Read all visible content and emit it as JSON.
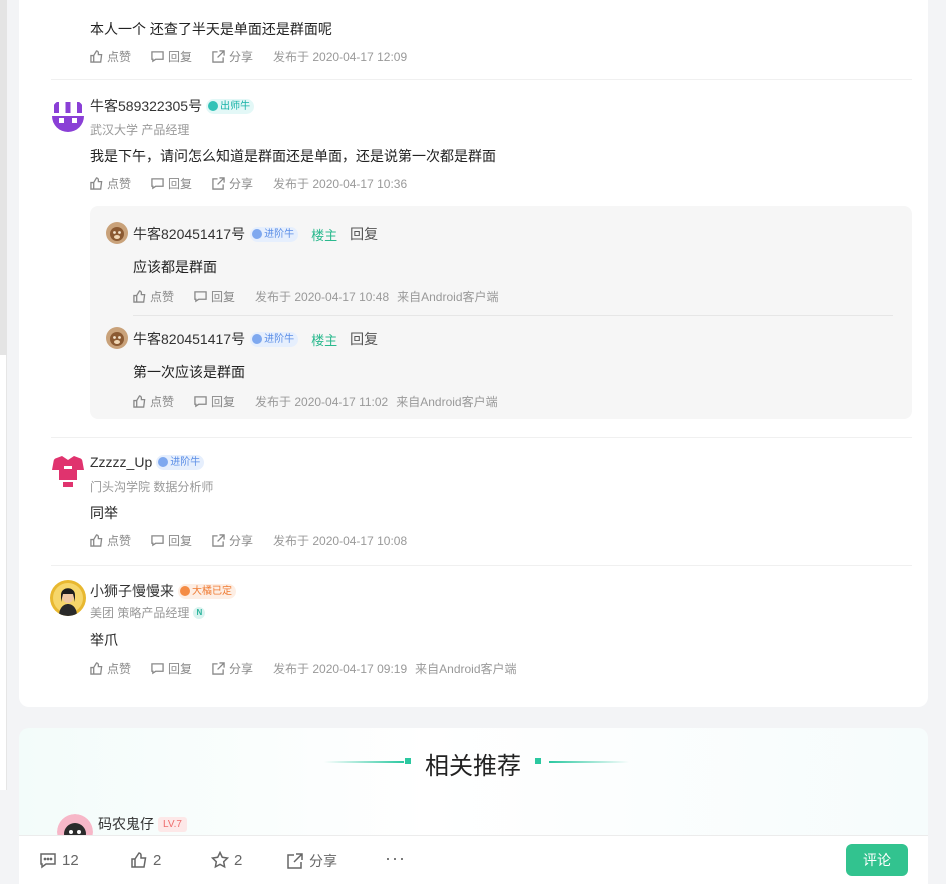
{
  "actions": {
    "like": "点赞",
    "reply": "回复",
    "share": "分享"
  },
  "comments": [
    {
      "text": "本人一个 还查了半天是单面还是群面呢",
      "meta": "发布于 2020-04-17 12:09"
    },
    {
      "name": "牛客589322305号",
      "badge": "出师牛",
      "sub": "武汉大学 产品经理",
      "text": "我是下午，请问怎么知道是群面还是单面，还是说第一次都是群面",
      "meta": "发布于 2020-04-17 10:36",
      "replies": [
        {
          "name": "牛客820451417号",
          "badge": "进阶牛",
          "tag": "楼主",
          "reply_label": "回复",
          "text": "应该都是群面",
          "meta": "发布于 2020-04-17 10:48",
          "client": "来自Android客户端"
        },
        {
          "name": "牛客820451417号",
          "badge": "进阶牛",
          "tag": "楼主",
          "reply_label": "回复",
          "text": "第一次应该是群面",
          "meta": "发布于 2020-04-17 11:02",
          "client": "来自Android客户端"
        }
      ]
    },
    {
      "name": "Zzzzz_Up",
      "badge": "进阶牛",
      "sub": "门头沟学院 数据分析师",
      "text": "同举",
      "meta": "发布于 2020-04-17 10:08"
    },
    {
      "name": "小狮子慢慢来",
      "badge": "大橘已定",
      "sub": "美团 策略产品经理",
      "sub_icon": "N",
      "text": "举爪",
      "meta": "发布于 2020-04-17 09:19",
      "client": "来自Android客户端"
    }
  ],
  "recommend": {
    "title": "相关推荐",
    "user": "码农鬼仔",
    "level": "LV.7"
  },
  "bottom_bar": {
    "comments": "12",
    "likes": "2",
    "stars": "2",
    "share": "分享",
    "more": "···",
    "comment_button": "评论"
  },
  "colors": {
    "accent": "#32c38f",
    "lz_tag": "#2bb98e"
  }
}
